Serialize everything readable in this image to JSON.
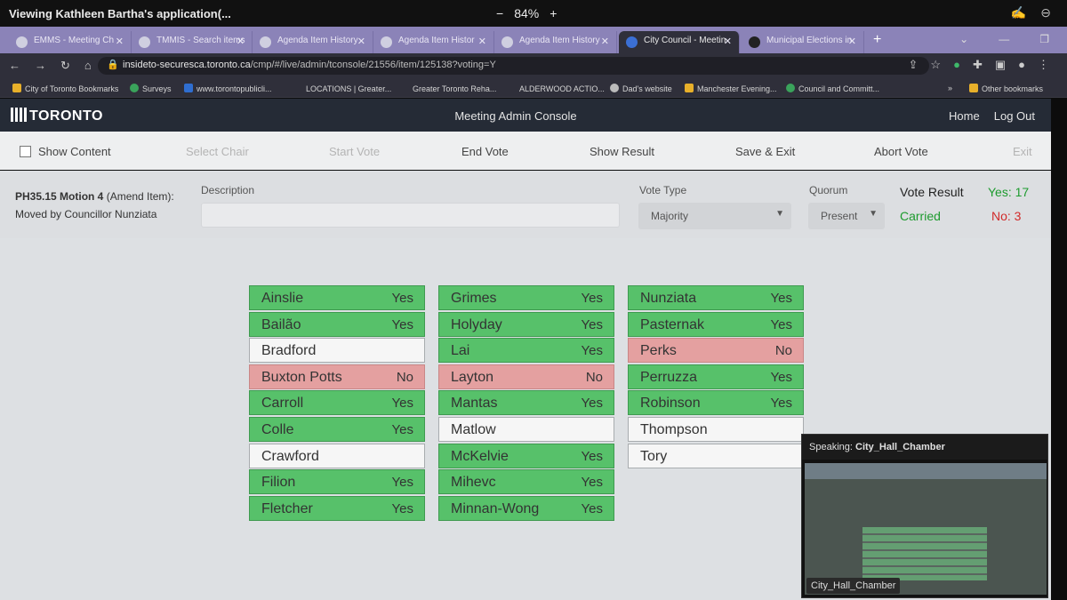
{
  "share_bar": {
    "title": "Viewing Kathleen Bartha's application(...",
    "zoom_minus": "−",
    "zoom": "84%",
    "zoom_plus": "+"
  },
  "tabs": [
    {
      "label": "EMMS - Meeting Ch",
      "active": false
    },
    {
      "label": "TMMIS - Search items",
      "active": false
    },
    {
      "label": "Agenda Item History",
      "active": false
    },
    {
      "label": "Agenda Item Histor",
      "active": false
    },
    {
      "label": "Agenda Item History",
      "active": false
    },
    {
      "label": "City Council - Meetin",
      "active": true
    },
    {
      "label": "Municipal Elections in",
      "active": false
    }
  ],
  "address": {
    "url_host": "insideto-securesca.toronto.ca",
    "url_path": "/cmp/#/live/admin/tconsole/21556/item/125138?voting=Y"
  },
  "bookmarks": [
    "City of Toronto Bookmarks",
    "Surveys",
    "www.torontopublicli...",
    "LOCATIONS | Greater...",
    "Greater Toronto Reha...",
    "ALDERWOOD ACTIO...",
    "Dad's website",
    "Manchester Evening...",
    "Council and Committ...",
    "Other bookmarks"
  ],
  "header": {
    "logo": "TORONTO",
    "title": "Meeting Admin Console",
    "home": "Home",
    "logout": "Log Out"
  },
  "toolbar": {
    "show_content": "Show Content",
    "select_chair": "Select Chair",
    "start_vote": "Start Vote",
    "end_vote": "End Vote",
    "show_result": "Show Result",
    "save_exit": "Save & Exit",
    "abort_vote": "Abort Vote",
    "exit": "Exit"
  },
  "motion": {
    "item": "PH35.15 Motion 4",
    "type": "(Amend Item):",
    "moved_by": "Moved by Councillor Nunziata",
    "description_label": "Description",
    "description_value": "",
    "vote_type_label": "Vote Type",
    "vote_type_value": "Majority",
    "quorum_label": "Quorum",
    "quorum_value": "Present"
  },
  "vote_result": {
    "title": "Vote Result",
    "yes": "Yes: 17",
    "status": "Carried",
    "no": "No: 3"
  },
  "councillors": [
    [
      {
        "name": "Ainslie",
        "vote": "Yes"
      },
      {
        "name": "Bailão",
        "vote": "Yes"
      },
      {
        "name": "Bradford",
        "vote": ""
      },
      {
        "name": "Buxton Potts",
        "vote": "No"
      },
      {
        "name": "Carroll",
        "vote": "Yes"
      },
      {
        "name": "Colle",
        "vote": "Yes"
      },
      {
        "name": "Crawford",
        "vote": ""
      },
      {
        "name": "Filion",
        "vote": "Yes"
      },
      {
        "name": "Fletcher",
        "vote": "Yes"
      }
    ],
    [
      {
        "name": "Grimes",
        "vote": "Yes"
      },
      {
        "name": "Holyday",
        "vote": "Yes"
      },
      {
        "name": "Lai",
        "vote": "Yes"
      },
      {
        "name": "Layton",
        "vote": "No"
      },
      {
        "name": "Mantas",
        "vote": "Yes"
      },
      {
        "name": "Matlow",
        "vote": ""
      },
      {
        "name": "McKelvie",
        "vote": "Yes"
      },
      {
        "name": "Mihevc",
        "vote": "Yes"
      },
      {
        "name": "Minnan-Wong",
        "vote": "Yes"
      }
    ],
    [
      {
        "name": "Nunziata",
        "vote": "Yes"
      },
      {
        "name": "Pasternak",
        "vote": "Yes"
      },
      {
        "name": "Perks",
        "vote": "No"
      },
      {
        "name": "Perruzza",
        "vote": "Yes"
      },
      {
        "name": "Robinson",
        "vote": "Yes"
      },
      {
        "name": "Thompson",
        "vote": ""
      },
      {
        "name": "Tory",
        "vote": ""
      }
    ]
  ],
  "speaking": {
    "label": "Speaking:",
    "source": "City_Hall_Chamber",
    "caption": "City_Hall_Chamber"
  }
}
